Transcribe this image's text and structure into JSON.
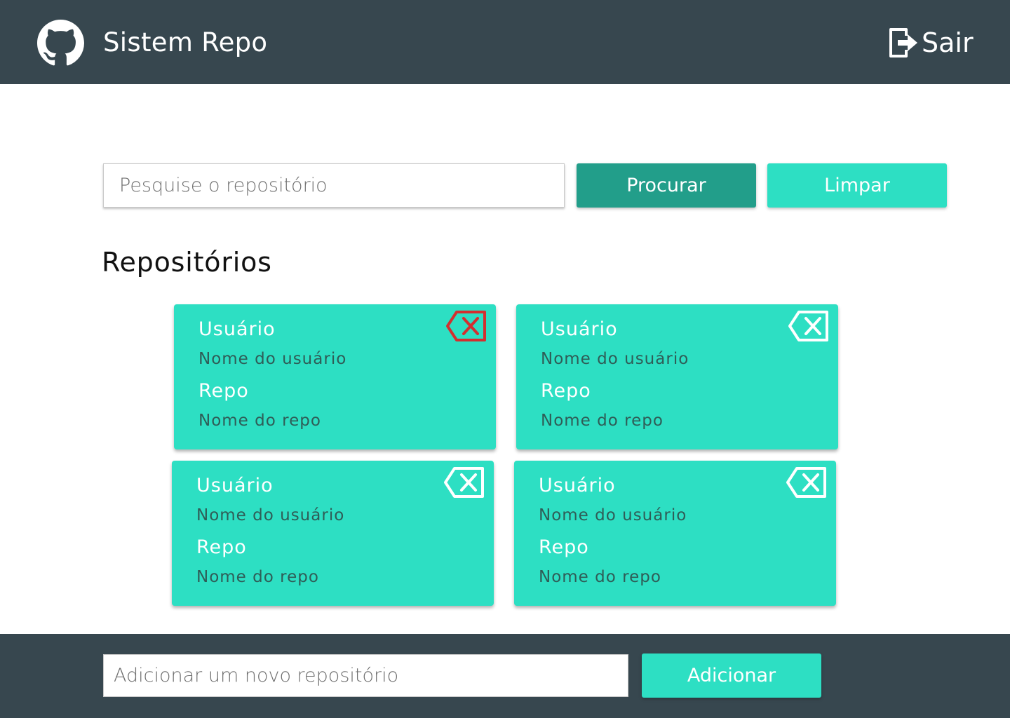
{
  "header": {
    "title": "Sistem Repo",
    "logo_icon": "github-icon",
    "logout_label": "Sair",
    "logout_icon": "sign-out-icon"
  },
  "search": {
    "placeholder": "Pesquise o repositório",
    "search_button": "Procurar",
    "clear_button": "Limpar"
  },
  "section": {
    "title": "Repositórios"
  },
  "cards": [
    {
      "user_label": "Usuário",
      "user_value": "Nome do usuário",
      "repo_label": "Repo",
      "repo_value": "Nome do repo",
      "delete_icon": "backspace-delete-icon",
      "delete_color": "#d32f2f"
    },
    {
      "user_label": "Usuário",
      "user_value": "Nome do usuário",
      "repo_label": "Repo",
      "repo_value": "Nome do repo",
      "delete_icon": "backspace-delete-icon",
      "delete_color": "#ffffff"
    },
    {
      "user_label": "Usuário",
      "user_value": "Nome do usuário",
      "repo_label": "Repo",
      "repo_value": "Nome do repo",
      "delete_icon": "backspace-delete-icon",
      "delete_color": "#ffffff"
    },
    {
      "user_label": "Usuário",
      "user_value": "Nome do usuário",
      "repo_label": "Repo",
      "repo_value": "Nome do repo",
      "delete_icon": "backspace-delete-icon",
      "delete_color": "#ffffff"
    }
  ],
  "footer": {
    "add_placeholder": "Adicionar um novo repositório",
    "add_button": "Adicionar"
  },
  "colors": {
    "bar": "#37474f",
    "accent": "#2ddfc3",
    "accent_dark": "#229e8a",
    "danger": "#d32f2f"
  }
}
